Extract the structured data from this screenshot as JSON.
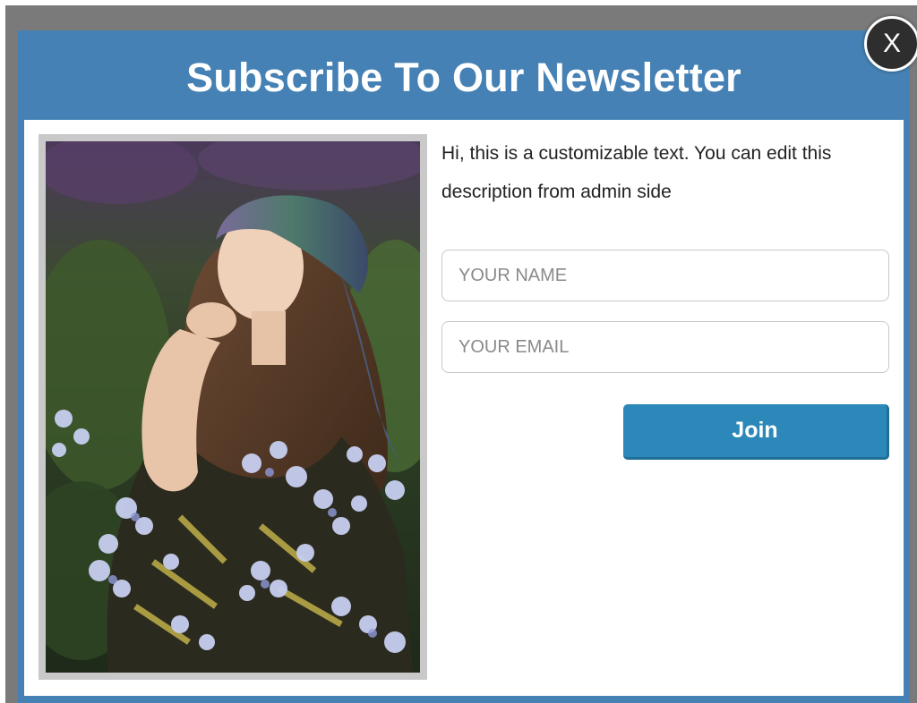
{
  "popup": {
    "title": "Subscribe To Our Newsletter",
    "close_label": "X",
    "description": "Hi, this is a customizable text. You can edit this description from admin side",
    "name_field": {
      "placeholder": "YOUR NAME",
      "value": ""
    },
    "email_field": {
      "placeholder": "YOUR EMAIL",
      "value": ""
    },
    "join_label": "Join"
  },
  "colors": {
    "overlay": "#7a7a7a",
    "header_blue": "#4581b4",
    "button_blue": "#2b88b8",
    "close_dark": "#2e2e2e"
  },
  "icons": {
    "close": "close-icon"
  }
}
